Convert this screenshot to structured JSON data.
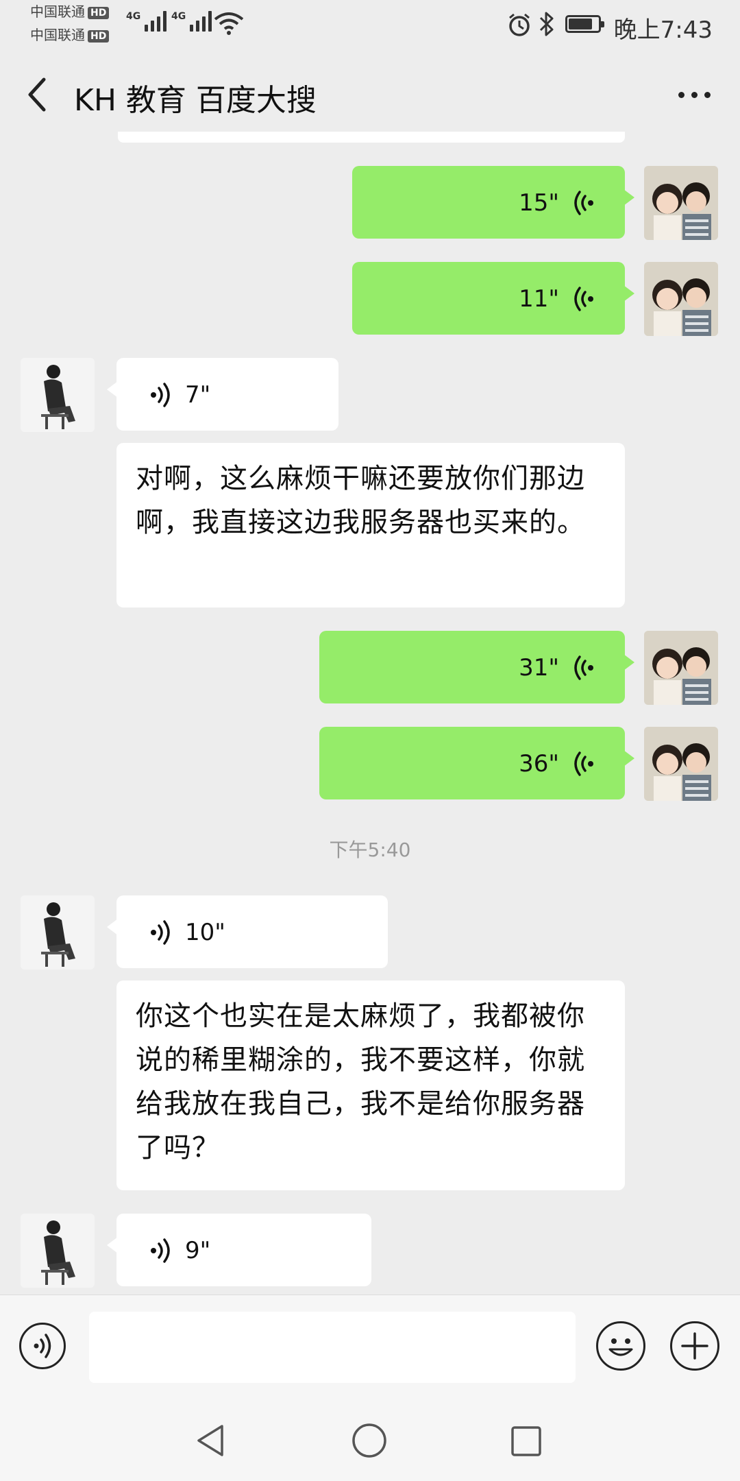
{
  "status_bar": {
    "carrier_1": "中国联通",
    "carrier_2": "中国联通",
    "hd_badge": "HD",
    "network_1": "4G",
    "network_2": "4G",
    "time": "晚上7:43",
    "icons": [
      "alarm-icon",
      "bluetooth-icon",
      "battery-icon",
      "wifi-icon",
      "signal-icon"
    ]
  },
  "header": {
    "title": "KH 教育 百度大搜",
    "back_icon": "chevron-left-icon",
    "more_icon": "more-icon"
  },
  "messages": [
    {
      "side": "right",
      "type": "voice",
      "duration": "15\""
    },
    {
      "side": "right",
      "type": "voice",
      "duration": "11\""
    },
    {
      "side": "left",
      "type": "voice",
      "duration": "7\""
    },
    {
      "side": "left",
      "type": "text",
      "text": "对啊，这么麻烦干嘛还要放你们那边啊，我直接这边我服务器也买来的。"
    },
    {
      "side": "right",
      "type": "voice",
      "duration": "31\""
    },
    {
      "side": "right",
      "type": "voice",
      "duration": "36\""
    },
    {
      "side": "left",
      "type": "voice",
      "duration": "10\""
    },
    {
      "side": "left",
      "type": "text",
      "text": "你这个也实在是太麻烦了，我都被你说的稀里糊涂的，我不要这样，你就给我放在我自己，我不是给你服务器了吗？"
    },
    {
      "side": "left",
      "type": "voice",
      "duration": "9\""
    }
  ],
  "timestamp": "下午5:40",
  "input_bar": {
    "value": "",
    "placeholder": "",
    "icons": [
      "voice-input-icon",
      "emoji-icon",
      "plus-icon"
    ]
  },
  "nav_bar": {
    "icons": [
      "back-triangle-icon",
      "home-circle-icon",
      "recent-square-icon"
    ]
  },
  "colors": {
    "background": "#ededed",
    "outgoing_bubble": "#95ec69",
    "incoming_bubble": "#ffffff"
  }
}
